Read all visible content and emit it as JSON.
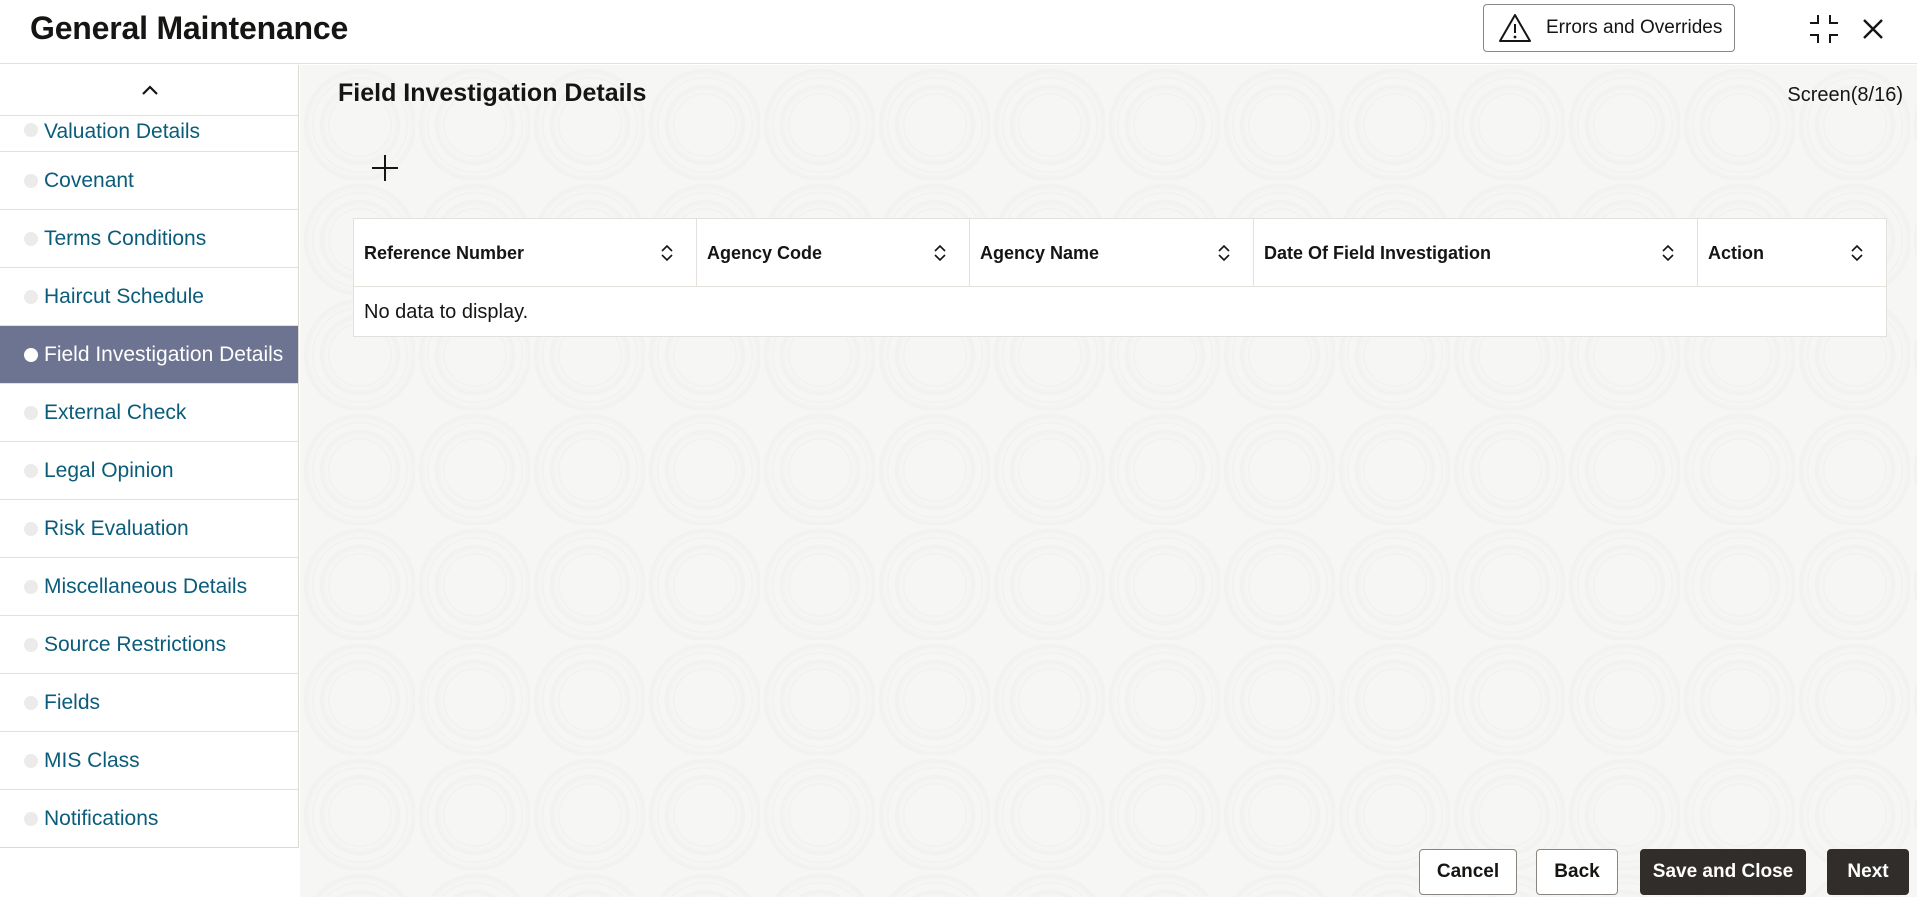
{
  "header": {
    "title": "General Maintenance",
    "errors_button": "Errors and Overrides",
    "icons": [
      "warning-icon",
      "collapse-icon",
      "close-icon"
    ]
  },
  "sidebar": {
    "items": [
      {
        "label": "Valuation Details",
        "active": false
      },
      {
        "label": "Covenant",
        "active": false
      },
      {
        "label": "Terms Conditions",
        "active": false
      },
      {
        "label": "Haircut Schedule",
        "active": false
      },
      {
        "label": "Field Investigation Details",
        "active": true
      },
      {
        "label": "External Check",
        "active": false
      },
      {
        "label": "Legal Opinion",
        "active": false
      },
      {
        "label": "Risk Evaluation",
        "active": false
      },
      {
        "label": "Miscellaneous Details",
        "active": false
      },
      {
        "label": "Source Restrictions",
        "active": false
      },
      {
        "label": "Fields",
        "active": false
      },
      {
        "label": "MIS Class",
        "active": false
      },
      {
        "label": "Notifications",
        "active": false
      }
    ]
  },
  "main": {
    "title": "Field Investigation Details",
    "screen_counter": "Screen(8/16)",
    "table": {
      "columns": [
        "Reference Number",
        "Agency Code",
        "Agency Name",
        "Date Of Field Investigation",
        "Action"
      ],
      "empty_message": "No data to display."
    }
  },
  "footer": {
    "cancel": "Cancel",
    "back": "Back",
    "save_close": "Save and Close",
    "next": "Next"
  },
  "colors": {
    "active_item_bg": "#6c7491",
    "link_text": "#0b5c7a",
    "primary_button": "#312d2a"
  }
}
